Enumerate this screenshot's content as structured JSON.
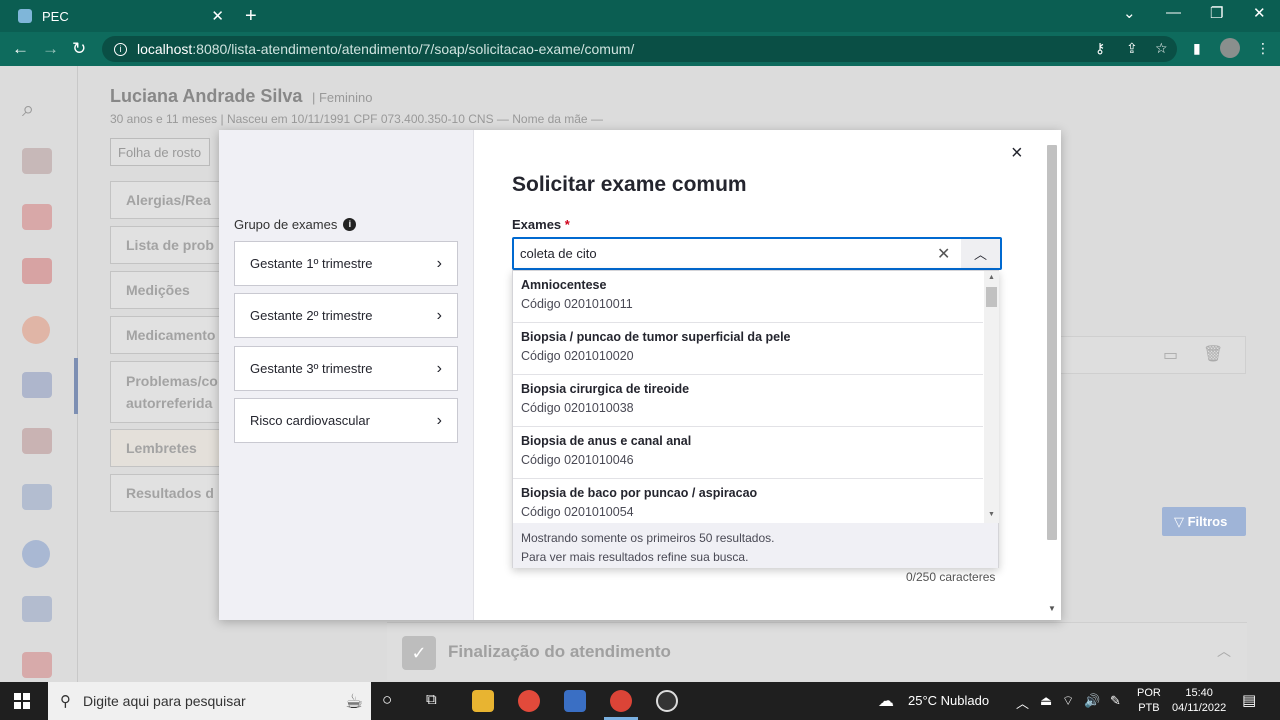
{
  "browser": {
    "tab_title": "PEC",
    "tab_close": "✕",
    "new_tab": "+",
    "url_host": "localhost",
    "url_path": ":8080/lista-atendimento/atendimento/7/soap/solicitacao-exame/comum/"
  },
  "patient": {
    "name": "Luciana Andrade Silva",
    "sex": "| Feminino",
    "info": "30 anos e 11 meses | Nasceu em 10/11/1991    CPF  073.400.350-10    CNS  —    Nome da mãe  —"
  },
  "background": {
    "folha_tab": "Folha de rosto",
    "left_items": [
      "Alergias/Rea",
      "Lista de prob",
      "Medições",
      "Medicamento",
      "Problemas/co",
      "autorreferida",
      "Lembretes",
      "Resultados d"
    ],
    "filtros_label": "Filtros",
    "finalizacao_title": "Finalização do atendimento"
  },
  "modal": {
    "title": "Solicitar exame comum",
    "close": "×",
    "group_label": "Grupo de exames",
    "groups": [
      "Gestante 1º trimestre",
      "Gestante 2º trimestre",
      "Gestante 3º trimestre",
      "Risco cardiovascular"
    ],
    "exames_label": "Exames",
    "required_mark": "*",
    "search_value": "coleta de cito",
    "char_count": "0/250 caracteres"
  },
  "dropdown": {
    "options": [
      {
        "name": "Amniocentese",
        "code": "Código 0201010011"
      },
      {
        "name": "Biopsia / puncao de tumor superficial da pele",
        "code": "Código 0201010020"
      },
      {
        "name": "Biopsia cirurgica de tireoide",
        "code": "Código 0201010038"
      },
      {
        "name": "Biopsia de anus e canal anal",
        "code": "Código 0201010046"
      },
      {
        "name": "Biopsia de baco por puncao / aspiracao",
        "code": "Código 0201010054"
      }
    ],
    "footer_line1": "Mostrando somente os primeiros 50 resultados.",
    "footer_line2": "Para ver mais resultados refine sua busca."
  },
  "taskbar": {
    "search_placeholder": "Digite aqui para pesquisar",
    "weather": "25°C  Nublado",
    "lang_top": "POR",
    "lang_bottom": "PTB",
    "time": "15:40",
    "date": "04/11/2022"
  },
  "colors": {
    "browser_bar": "#0b5e52",
    "accent_blue": "#0069d0",
    "required_red": "#d0021b"
  }
}
